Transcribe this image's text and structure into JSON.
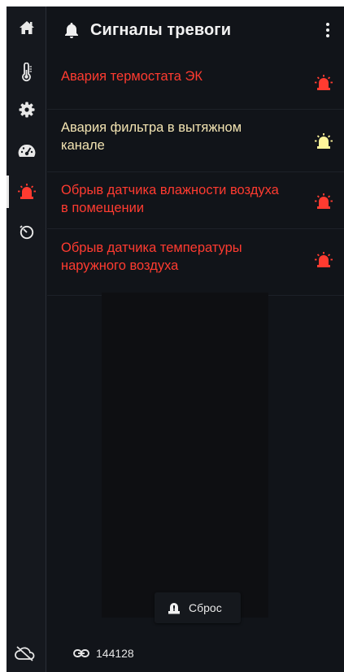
{
  "header": {
    "title": "Сигналы тревоги",
    "icon": "bell-icon",
    "menu_icon": "more-vertical-icon"
  },
  "sidebar": {
    "items": [
      {
        "icon": "home-icon",
        "active": false
      },
      {
        "icon": "thermometer-icon",
        "active": false
      },
      {
        "icon": "gear-icon",
        "active": false
      },
      {
        "icon": "speedometer-icon",
        "active": false
      },
      {
        "icon": "alarm-light-icon",
        "active": true
      },
      {
        "icon": "timer-icon",
        "active": false
      }
    ],
    "status_icon": "cloud-off-icon"
  },
  "alarms": [
    {
      "text": "Авария термостата ЭК",
      "color": "#ff3b30",
      "icon": "alarm-light-icon",
      "icon_color": "#ff3b30"
    },
    {
      "text": "Авария фильтра в вытяжном канале",
      "color": "#f3e4b2",
      "icon": "alarm-light-icon",
      "icon_color": "#fff59a"
    },
    {
      "text": "Обрыв датчика влажности воздуха в помещении",
      "color": "#ff3b30",
      "icon": "alarm-light-icon",
      "icon_color": "#ff3b30"
    },
    {
      "text": "Обрыв датчика температуры наружного воздуха",
      "color": "#ff3b30",
      "icon": "alarm-light-icon",
      "icon_color": "#ff3b30"
    }
  ],
  "reset_button": {
    "label": "Сброс",
    "icon": "alarm-reset-icon"
  },
  "footer": {
    "link_icon": "link-icon",
    "device_id": "144128"
  },
  "colors": {
    "background": "#111419",
    "sidebar": "#15181e",
    "alarm_red": "#ff3b30",
    "alarm_yellow": "#fff59a"
  }
}
